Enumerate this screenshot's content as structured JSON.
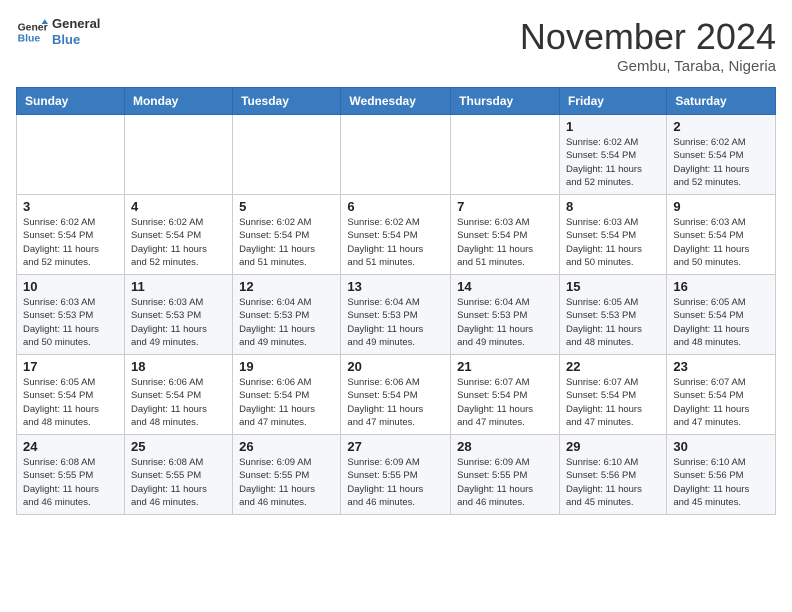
{
  "header": {
    "logo_line1": "General",
    "logo_line2": "Blue",
    "month": "November 2024",
    "location": "Gembu, Taraba, Nigeria"
  },
  "weekdays": [
    "Sunday",
    "Monday",
    "Tuesday",
    "Wednesday",
    "Thursday",
    "Friday",
    "Saturday"
  ],
  "weeks": [
    [
      {
        "day": "",
        "info": ""
      },
      {
        "day": "",
        "info": ""
      },
      {
        "day": "",
        "info": ""
      },
      {
        "day": "",
        "info": ""
      },
      {
        "day": "",
        "info": ""
      },
      {
        "day": "1",
        "info": "Sunrise: 6:02 AM\nSunset: 5:54 PM\nDaylight: 11 hours\nand 52 minutes."
      },
      {
        "day": "2",
        "info": "Sunrise: 6:02 AM\nSunset: 5:54 PM\nDaylight: 11 hours\nand 52 minutes."
      }
    ],
    [
      {
        "day": "3",
        "info": "Sunrise: 6:02 AM\nSunset: 5:54 PM\nDaylight: 11 hours\nand 52 minutes."
      },
      {
        "day": "4",
        "info": "Sunrise: 6:02 AM\nSunset: 5:54 PM\nDaylight: 11 hours\nand 52 minutes."
      },
      {
        "day": "5",
        "info": "Sunrise: 6:02 AM\nSunset: 5:54 PM\nDaylight: 11 hours\nand 51 minutes."
      },
      {
        "day": "6",
        "info": "Sunrise: 6:02 AM\nSunset: 5:54 PM\nDaylight: 11 hours\nand 51 minutes."
      },
      {
        "day": "7",
        "info": "Sunrise: 6:03 AM\nSunset: 5:54 PM\nDaylight: 11 hours\nand 51 minutes."
      },
      {
        "day": "8",
        "info": "Sunrise: 6:03 AM\nSunset: 5:54 PM\nDaylight: 11 hours\nand 50 minutes."
      },
      {
        "day": "9",
        "info": "Sunrise: 6:03 AM\nSunset: 5:54 PM\nDaylight: 11 hours\nand 50 minutes."
      }
    ],
    [
      {
        "day": "10",
        "info": "Sunrise: 6:03 AM\nSunset: 5:53 PM\nDaylight: 11 hours\nand 50 minutes."
      },
      {
        "day": "11",
        "info": "Sunrise: 6:03 AM\nSunset: 5:53 PM\nDaylight: 11 hours\nand 49 minutes."
      },
      {
        "day": "12",
        "info": "Sunrise: 6:04 AM\nSunset: 5:53 PM\nDaylight: 11 hours\nand 49 minutes."
      },
      {
        "day": "13",
        "info": "Sunrise: 6:04 AM\nSunset: 5:53 PM\nDaylight: 11 hours\nand 49 minutes."
      },
      {
        "day": "14",
        "info": "Sunrise: 6:04 AM\nSunset: 5:53 PM\nDaylight: 11 hours\nand 49 minutes."
      },
      {
        "day": "15",
        "info": "Sunrise: 6:05 AM\nSunset: 5:53 PM\nDaylight: 11 hours\nand 48 minutes."
      },
      {
        "day": "16",
        "info": "Sunrise: 6:05 AM\nSunset: 5:54 PM\nDaylight: 11 hours\nand 48 minutes."
      }
    ],
    [
      {
        "day": "17",
        "info": "Sunrise: 6:05 AM\nSunset: 5:54 PM\nDaylight: 11 hours\nand 48 minutes."
      },
      {
        "day": "18",
        "info": "Sunrise: 6:06 AM\nSunset: 5:54 PM\nDaylight: 11 hours\nand 48 minutes."
      },
      {
        "day": "19",
        "info": "Sunrise: 6:06 AM\nSunset: 5:54 PM\nDaylight: 11 hours\nand 47 minutes."
      },
      {
        "day": "20",
        "info": "Sunrise: 6:06 AM\nSunset: 5:54 PM\nDaylight: 11 hours\nand 47 minutes."
      },
      {
        "day": "21",
        "info": "Sunrise: 6:07 AM\nSunset: 5:54 PM\nDaylight: 11 hours\nand 47 minutes."
      },
      {
        "day": "22",
        "info": "Sunrise: 6:07 AM\nSunset: 5:54 PM\nDaylight: 11 hours\nand 47 minutes."
      },
      {
        "day": "23",
        "info": "Sunrise: 6:07 AM\nSunset: 5:54 PM\nDaylight: 11 hours\nand 47 minutes."
      }
    ],
    [
      {
        "day": "24",
        "info": "Sunrise: 6:08 AM\nSunset: 5:55 PM\nDaylight: 11 hours\nand 46 minutes."
      },
      {
        "day": "25",
        "info": "Sunrise: 6:08 AM\nSunset: 5:55 PM\nDaylight: 11 hours\nand 46 minutes."
      },
      {
        "day": "26",
        "info": "Sunrise: 6:09 AM\nSunset: 5:55 PM\nDaylight: 11 hours\nand 46 minutes."
      },
      {
        "day": "27",
        "info": "Sunrise: 6:09 AM\nSunset: 5:55 PM\nDaylight: 11 hours\nand 46 minutes."
      },
      {
        "day": "28",
        "info": "Sunrise: 6:09 AM\nSunset: 5:55 PM\nDaylight: 11 hours\nand 46 minutes."
      },
      {
        "day": "29",
        "info": "Sunrise: 6:10 AM\nSunset: 5:56 PM\nDaylight: 11 hours\nand 45 minutes."
      },
      {
        "day": "30",
        "info": "Sunrise: 6:10 AM\nSunset: 5:56 PM\nDaylight: 11 hours\nand 45 minutes."
      }
    ]
  ]
}
